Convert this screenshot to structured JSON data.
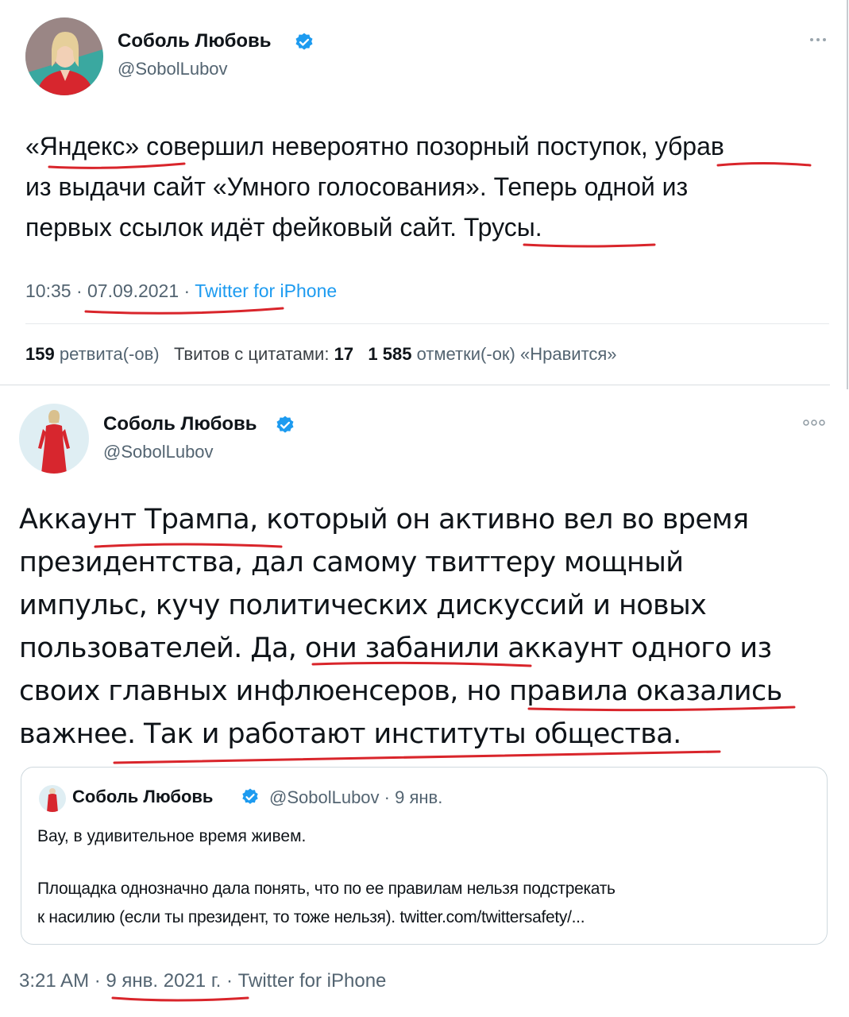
{
  "tweet1": {
    "author": "Соболь Любовь",
    "handle": "@SobolLubov",
    "text_lines": [
      "«Яндекс» совершил невероятно позорный поступок, убрав",
      "из выдачи сайт «Умного голосования». Теперь одной из",
      "первых ссылок идёт фейковый сайт. Трусы."
    ],
    "time": "10:35",
    "sep": "·",
    "date": "07.09.2021",
    "source": "Twitter for iPhone",
    "stats": {
      "retweets_count": "159",
      "retweets_label": "ретвита(-ов)",
      "quotes_label": "Твитов с цитатами:",
      "quotes_count": "17",
      "likes_count": "1 585",
      "likes_label": "отметки(-ок) «Нравится»"
    },
    "more_icon": "more-dots-icon"
  },
  "tweet2": {
    "author": "Соболь Любовь",
    "handle": "@SobolLubov",
    "text_lines": [
      "Аккаунт Трампа, который он активно вел во время",
      "президентства, дал самому твиттеру мощный",
      "импульс, кучу политических дискуссий и новых",
      "пользователей. Да, они забанили аккаунт одного из",
      "своих главных инфлюенсеров, но правила оказались",
      "важнее. Так и работают институты общества."
    ],
    "quote": {
      "author": "Соболь Любовь",
      "handle_date": "@SobolLubov · 9 янв.",
      "line1": "Вау, в удивительное время живем.",
      "line2": "Площадка однозначно дала понять, что по ее правилам нельзя подстрекать",
      "line3": "к насилию (если ты президент, то тоже нельзя). twitter.com/twittersafety/..."
    },
    "time": "3:21 AM",
    "sep": "·",
    "date": "9 янв. 2021 г.",
    "source": "Twitter for iPhone",
    "more_icon": "more-dots-icon"
  },
  "colors": {
    "accent": "#1d9bf0",
    "annotation": "#d9252b",
    "muted": "#536471",
    "avatar1_bg": "#3aa8a0",
    "avatar_dress": "#d7262e"
  }
}
